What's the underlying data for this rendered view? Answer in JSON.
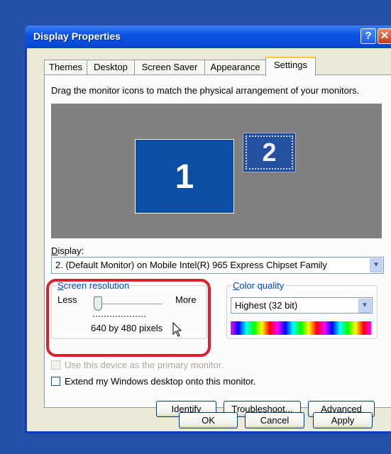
{
  "window": {
    "title": "Display Properties",
    "help_glyph": "?",
    "close_glyph": "✕"
  },
  "tabs": [
    {
      "label": "Themes"
    },
    {
      "label": "Desktop"
    },
    {
      "label": "Screen Saver"
    },
    {
      "label": "Appearance"
    },
    {
      "label": "Settings",
      "active": true
    }
  ],
  "settings": {
    "instruction": "Drag the monitor icons to match the physical arrangement of your monitors.",
    "monitors": [
      {
        "label": "1"
      },
      {
        "label": "2"
      }
    ],
    "display_label": "Display:",
    "display_value": "2. (Default Monitor) on Mobile Intel(R) 965 Express Chipset Family",
    "screen_resolution": {
      "legend": "Screen resolution",
      "less": "Less",
      "more": "More",
      "value": "640 by 480 pixels"
    },
    "color_quality": {
      "legend": "Color quality",
      "value": "Highest (32 bit)"
    },
    "primary_monitor_label": "Use this device as the primary monitor.",
    "extend_label": "Extend my Windows desktop onto this monitor.",
    "buttons": {
      "identify": "Identify",
      "troubleshoot": "Troubleshoot...",
      "advanced": "Advanced"
    }
  },
  "footer": {
    "ok": "OK",
    "cancel": "Cancel",
    "apply": "Apply"
  },
  "colors": {
    "desktop": "#2450a8",
    "titlebar": "#0a53e4",
    "highlight": "#e0202a"
  }
}
